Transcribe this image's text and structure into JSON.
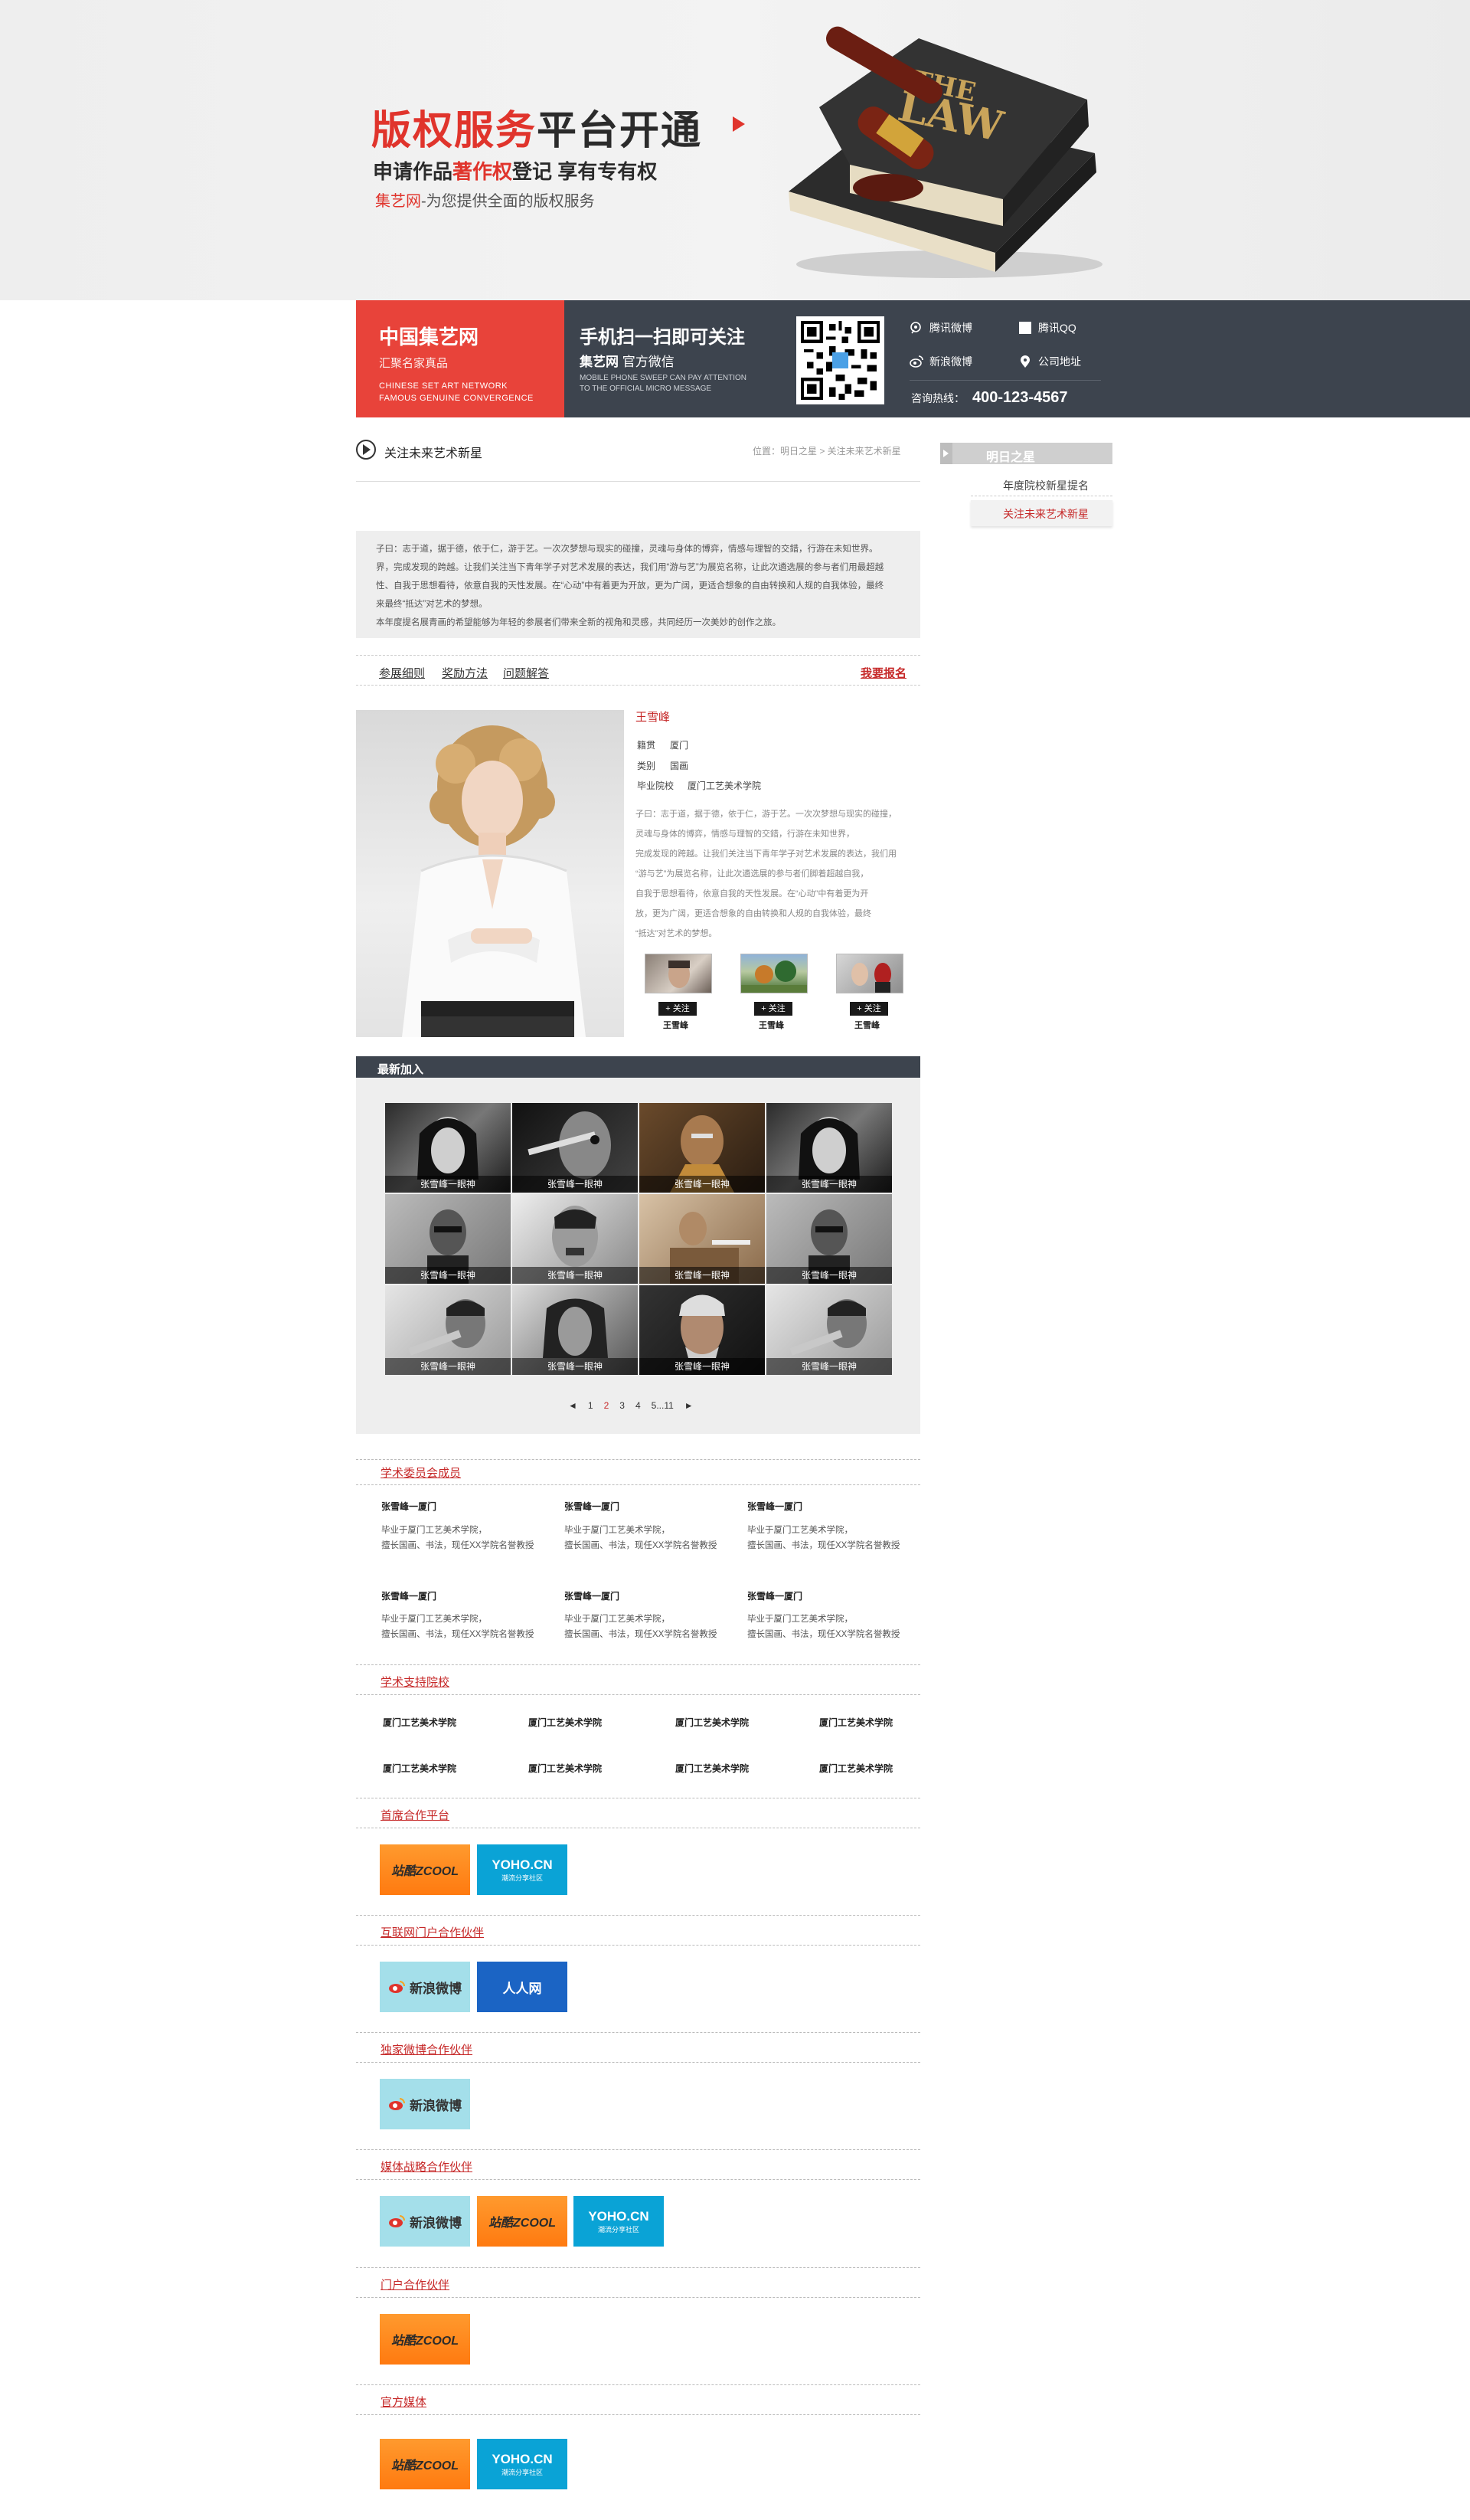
{
  "banner": {
    "title_red": "版权服务",
    "title_dark": "平台开通",
    "sub_pre": "申请作品",
    "sub_red": "著作权",
    "sub_post": "登记 享有专有权",
    "desc_red": "集艺网",
    "desc_post": "-为您提供全面的版权服务"
  },
  "brand": {
    "title": "中国集艺网",
    "sub": "汇聚名家真品",
    "en1": "CHINESE SET ART NETWORK",
    "en2": "FAMOUS GENUINE CONVERGENCE"
  },
  "wechat": {
    "title": "手机扫一扫即可关注",
    "sub_bold": "集艺网",
    "sub": "官方微信",
    "en1": "MOBILE PHONE SWEEP CAN PAY ATTENTION",
    "en2": "TO THE OFFICIAL MICRO MESSAGE"
  },
  "social": {
    "tencent_weibo": "腾讯微博",
    "tencent_qq": "腾讯QQ",
    "sina_weibo": "新浪微博",
    "address": "公司地址",
    "hotline_label": "咨询热线：",
    "hotline": "400-123-4567"
  },
  "page": {
    "heading": "关注未来艺术新星",
    "location": "位置：明日之星 > 关注未来艺术新星"
  },
  "sidebar": {
    "title": "明日之星",
    "items": [
      "年度院校新星提名",
      "关注未来艺术新星"
    ]
  },
  "intro": {
    "lines": [
      "子曰：志于道，据于德，依于仁，游于艺。一次次梦想与现实的碰撞，灵魂与身体的博弈，情感与理智的交錯，行游在未知世界。",
      "界，完成发现的跨越。让我们关注当下青年学子对艺术发展的表达，我们用“游与艺”为展览名称，让此次遴选展的参与者们用最超越",
      "性、自我于思想看待，依意自我的天性发展。在“心动”中有着更为开放，更为广阔，更适合想象的自由转换和人规的自我体验，最终",
      "来最终“抵达”对艺术的梦想。",
      "本年度提名展青画的希望能够为年轻的参展者们带来全新的视角和灵感，共同经历一次美妙的创作之旅。"
    ]
  },
  "tabs": {
    "items": [
      "参展细则",
      "奖励方法",
      "问题解答"
    ],
    "signup": "我要报名"
  },
  "profile": {
    "name": "王雪峰",
    "label1": "籍贯",
    "value1": "厦门",
    "label2": "类别",
    "value2": "国画",
    "label3": "毕业院校",
    "value3": "厦门工艺美术学院",
    "bio_lines": [
      "子曰：志于道，据于德，依于仁，游于艺。一次次梦想与现实的碰撞，",
      "灵魂与身体的博弈，情感与理智的交錯，行游在未知世界，",
      "完成发现的跨越。让我们关注当下青年学子对艺术发展的表达，我们用",
      "“游与艺”为展览名称，让此次遴选展的参与者们脚着超越自我，",
      "自我于思想看待，依意自我的天性发展。在“心动”中有着更为开",
      "放，更为广阔，更适合想象的自由转换和人规的自我体验，最终",
      "“抵达”对艺术的梦想。"
    ],
    "follow_label": "+ 关注",
    "followers": [
      "王雪峰",
      "王雪峰",
      "王雪峰"
    ]
  },
  "latest": {
    "title": "最新加入",
    "caption": "张雪峰一眼神",
    "pager": [
      "◄",
      "1",
      "2",
      "3",
      "4",
      "5...11",
      "►"
    ]
  },
  "committee": {
    "title": "学术委员会成员",
    "name": "张雪峰一厦门",
    "desc1": "毕业于厦门工艺美术学院，",
    "desc2": "擅长国画、书法，现任XX学院名誉教授"
  },
  "schools": {
    "title": "学术支持院校",
    "name": "厦门工艺美术学院"
  },
  "partners": [
    {
      "title": "首席合作平台"
    },
    {
      "title": "互联网门户合作伙伴"
    },
    {
      "title": "独家微博合作伙伴"
    },
    {
      "title": "媒体战略合作伙伴"
    },
    {
      "title": "门户合作伙伴"
    },
    {
      "title": "官方媒体"
    }
  ],
  "logos": {
    "zcool": "站酷ZCOOL",
    "yoho": "YOHO.CN",
    "yoho_sub": "潮流分享社区",
    "weibo": "新浪微博",
    "renren": "人人网"
  }
}
